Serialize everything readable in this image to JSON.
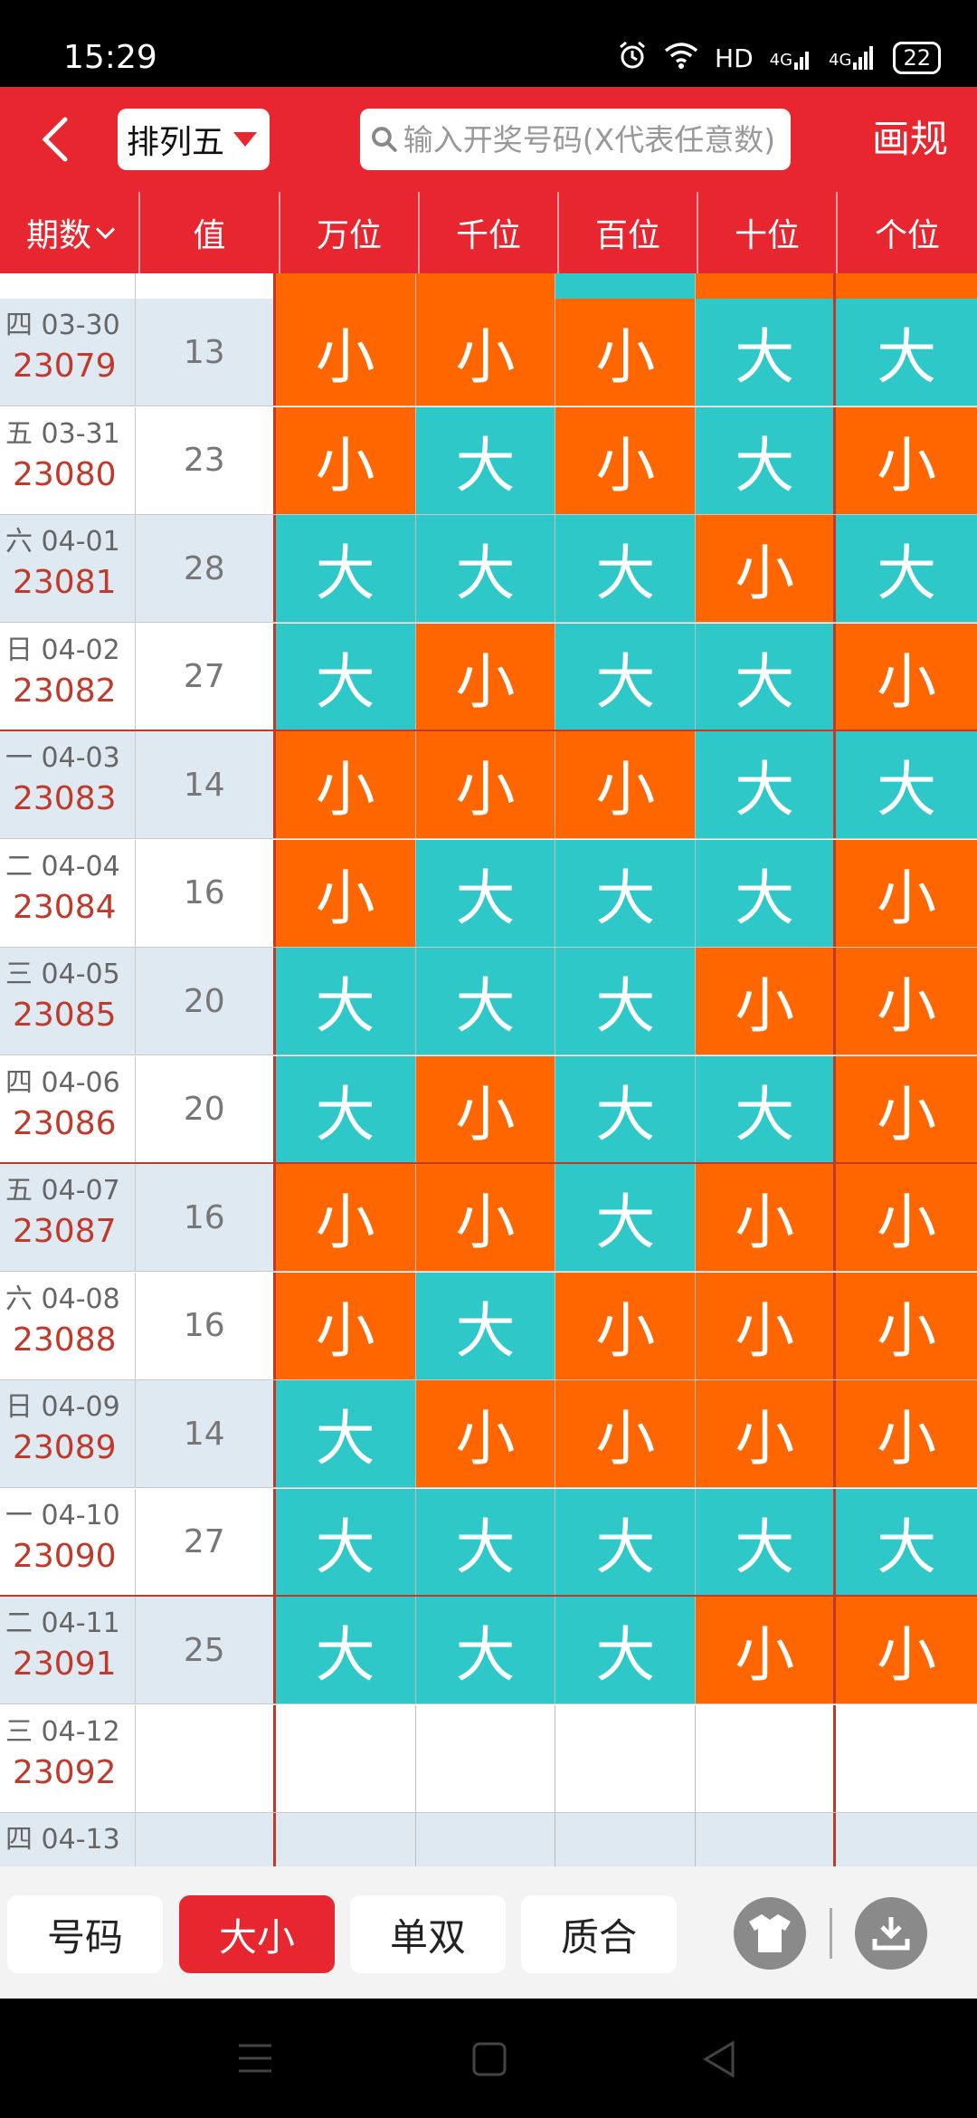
{
  "status": {
    "time": "15:29",
    "hd": "HD",
    "net1": "4G",
    "net2": "4G",
    "battery": "22"
  },
  "header": {
    "lottery": "排列五",
    "search_placeholder": "输入开奖号码(X代表任意数)",
    "draw_rule": "画规"
  },
  "columns": {
    "period": "期数",
    "value": "值",
    "wan": "万位",
    "qian": "千位",
    "bai": "百位",
    "shi": "十位",
    "ge": "个位"
  },
  "rows": [
    {
      "date": "四 03-30",
      "issue": "23079",
      "value": "13",
      "cells": [
        "小",
        "小",
        "小",
        "大",
        "大"
      ]
    },
    {
      "date": "五 03-31",
      "issue": "23080",
      "value": "23",
      "cells": [
        "小",
        "大",
        "小",
        "大",
        "小"
      ]
    },
    {
      "date": "六 04-01",
      "issue": "23081",
      "value": "28",
      "cells": [
        "大",
        "大",
        "大",
        "小",
        "大"
      ]
    },
    {
      "date": "日 04-02",
      "issue": "23082",
      "value": "27",
      "cells": [
        "大",
        "小",
        "大",
        "大",
        "小"
      ]
    },
    {
      "date": "一 04-03",
      "issue": "23083",
      "value": "14",
      "cells": [
        "小",
        "小",
        "小",
        "大",
        "大"
      ]
    },
    {
      "date": "二 04-04",
      "issue": "23084",
      "value": "16",
      "cells": [
        "小",
        "大",
        "大",
        "大",
        "小"
      ]
    },
    {
      "date": "三 04-05",
      "issue": "23085",
      "value": "20",
      "cells": [
        "大",
        "大",
        "大",
        "小",
        "小"
      ]
    },
    {
      "date": "四 04-06",
      "issue": "23086",
      "value": "20",
      "cells": [
        "大",
        "小",
        "大",
        "大",
        "小"
      ]
    },
    {
      "date": "五 04-07",
      "issue": "23087",
      "value": "16",
      "cells": [
        "小",
        "小",
        "大",
        "小",
        "小"
      ]
    },
    {
      "date": "六 04-08",
      "issue": "23088",
      "value": "16",
      "cells": [
        "小",
        "大",
        "小",
        "小",
        "小"
      ]
    },
    {
      "date": "日 04-09",
      "issue": "23089",
      "value": "14",
      "cells": [
        "大",
        "小",
        "小",
        "小",
        "小"
      ]
    },
    {
      "date": "一 04-10",
      "issue": "23090",
      "value": "27",
      "cells": [
        "大",
        "大",
        "大",
        "大",
        "大"
      ]
    },
    {
      "date": "二 04-11",
      "issue": "23091",
      "value": "25",
      "cells": [
        "大",
        "大",
        "大",
        "小",
        "小"
      ]
    },
    {
      "date": "三 04-12",
      "issue": "23092",
      "value": "",
      "cells": [
        "",
        "",
        "",
        "",
        ""
      ]
    },
    {
      "date": "四 04-13",
      "issue": "",
      "value": "",
      "cells": [
        "",
        "",
        "",
        "",
        ""
      ]
    }
  ],
  "colors": {
    "small": "#ff6600",
    "big": "#2ec8c8",
    "accent": "#e8262f"
  },
  "toolbar": {
    "tab_number": "号码",
    "tab_size": "大小",
    "tab_parity": "单双",
    "tab_prime": "质合"
  },
  "icons": [
    "back-arrow-icon",
    "caret-down-icon",
    "search-icon",
    "shirt-icon",
    "download-icon",
    "menu-icon",
    "home-square-icon",
    "back-triangle-icon"
  ]
}
